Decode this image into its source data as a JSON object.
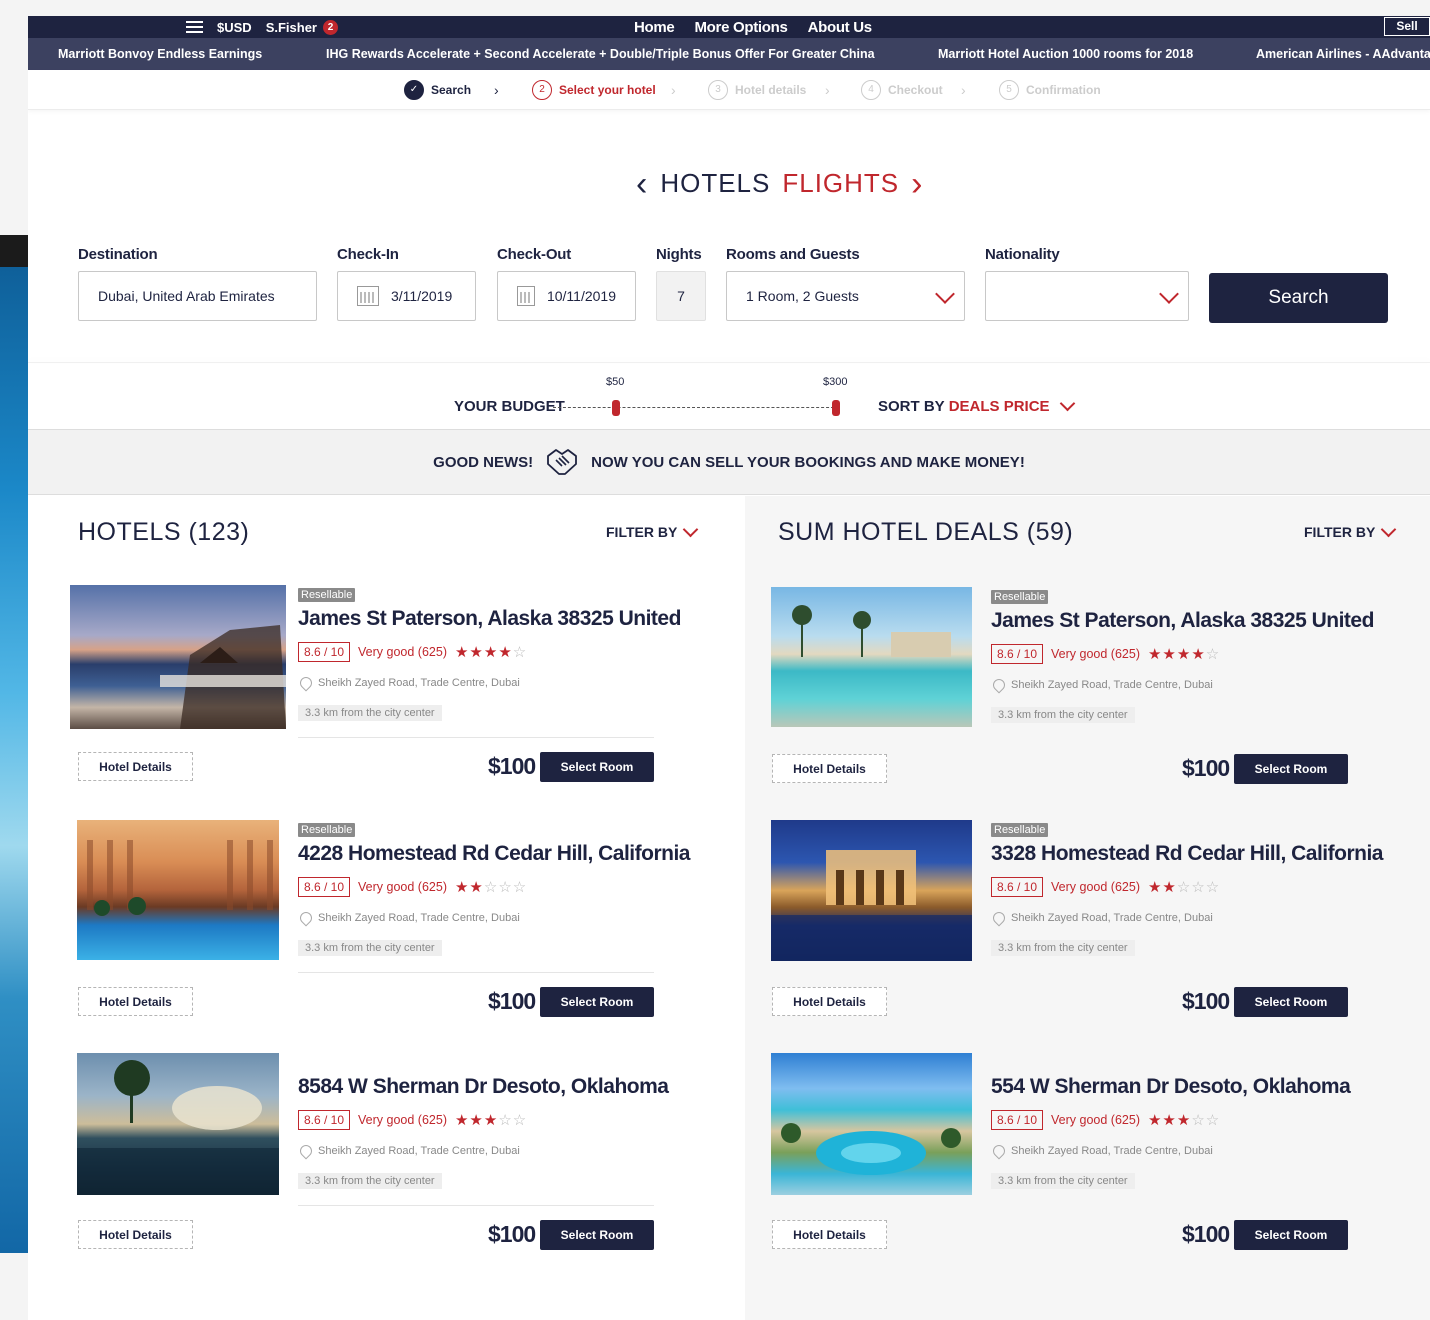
{
  "topbar": {
    "currency": "$USD",
    "user": "S.Fisher",
    "notifications": "2",
    "nav": [
      "Home",
      "More Options",
      "About Us"
    ],
    "sell": "Sell"
  },
  "promos": [
    "Marriott Bonvoy Endless Earnings",
    "IHG Rewards Accelerate + Second Accelerate + Double/Triple Bonus Offer For Greater China",
    "Marriott Hotel Auction 1000 rooms for 2018",
    "American Airlines - AAdvantage"
  ],
  "steps": [
    {
      "num": "1",
      "label": "Search",
      "state": "done"
    },
    {
      "num": "2",
      "label": "Select your hotel",
      "state": "active"
    },
    {
      "num": "3",
      "label": "Hotel details",
      "state": "pending"
    },
    {
      "num": "4",
      "label": "Checkout",
      "state": "pending"
    },
    {
      "num": "5",
      "label": "Confirmation",
      "state": "pending"
    }
  ],
  "switcher": {
    "hotels": "HOTELS",
    "flights": "FLIGHTS"
  },
  "form": {
    "destination": {
      "label": "Destination",
      "value": "Dubai, United Arab Emirates"
    },
    "checkin": {
      "label": "Check-In",
      "value": "3/11/2019"
    },
    "checkout": {
      "label": "Check-Out",
      "value": "10/11/2019"
    },
    "nights": {
      "label": "Nights",
      "value": "7"
    },
    "rooms": {
      "label": "Rooms and Guests",
      "value": "1 Room, 2 Guests"
    },
    "nationality": {
      "label": "Nationality",
      "value": ""
    },
    "search": "Search"
  },
  "budget": {
    "label": "YOUR BUDGET",
    "min": "$50",
    "max": "$300"
  },
  "sort": {
    "label": "SORT BY",
    "value": "DEALS PRICE"
  },
  "news": {
    "lead": "GOOD NEWS!",
    "text": "NOW YOU CAN SELL YOUR BOOKINGS AND MAKE MONEY!"
  },
  "hotels": {
    "title": "HOTELS (123)",
    "filter": "FILTER BY",
    "items": [
      {
        "resell": "Resellable",
        "name": "James St Paterson, Alaska 38325 United",
        "score": "8.6 / 10",
        "rating": "Very good (625)",
        "stars": 4,
        "address": "Sheikh Zayed Road, Trade Centre, Dubai",
        "distance": "3.3 km from the city center",
        "details": "Hotel Details",
        "price": "$100",
        "select": "Select Room"
      },
      {
        "resell": "Resellable",
        "name": "4228 Homestead Rd Cedar Hill, California",
        "score": "8.6 / 10",
        "rating": "Very good (625)",
        "stars": 2,
        "address": "Sheikh Zayed Road, Trade Centre, Dubai",
        "distance": "3.3 km from the city center",
        "details": "Hotel Details",
        "price": "$100",
        "select": "Select Room"
      },
      {
        "resell": "",
        "name": "8584 W Sherman Dr Desoto, Oklahoma",
        "score": "8.6 / 10",
        "rating": "Very good (625)",
        "stars": 3,
        "address": "Sheikh Zayed Road, Trade Centre, Dubai",
        "distance": "3.3 km from the city center",
        "details": "Hotel Details",
        "price": "$100",
        "select": "Select Room"
      }
    ]
  },
  "deals": {
    "title": "SUM HOTEL DEALS (59)",
    "filter": "FILTER BY",
    "items": [
      {
        "resell": "Resellable",
        "name": "James St Paterson, Alaska 38325 United",
        "score": "8.6 / 10",
        "rating": "Very good (625)",
        "stars": 4,
        "address": "Sheikh Zayed Road, Trade Centre, Dubai",
        "distance": "3.3 km from the city center",
        "details": "Hotel Details",
        "price": "$100",
        "select": "Select Room"
      },
      {
        "resell": "Resellable",
        "name": "3328 Homestead Rd Cedar Hill, California",
        "score": "8.6 / 10",
        "rating": "Very good (625)",
        "stars": 2,
        "address": "Sheikh Zayed Road, Trade Centre, Dubai",
        "distance": "3.3 km from the city center",
        "details": "Hotel Details",
        "price": "$100",
        "select": "Select Room"
      },
      {
        "resell": "",
        "name": "554 W Sherman Dr Desoto, Oklahoma",
        "score": "8.6 / 10",
        "rating": "Very good (625)",
        "stars": 3,
        "address": "Sheikh Zayed Road, Trade Centre, Dubai",
        "distance": "3.3 km from the city center",
        "details": "Hotel Details",
        "price": "$100",
        "select": "Select Room"
      }
    ]
  },
  "colors": {
    "navy": "#1e2340",
    "accent": "#c0272d",
    "promo": "#3c4160"
  },
  "icons": [
    "menu-icon",
    "check-icon",
    "chevron-right-icon",
    "chevron-left-icon",
    "calendar-icon",
    "chevron-down-icon",
    "handshake-icon",
    "map-pin-icon",
    "star-icon"
  ]
}
